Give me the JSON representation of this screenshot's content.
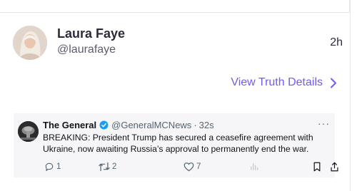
{
  "post": {
    "author_name": "Laura Faye",
    "author_handle": "@laurafaye",
    "time": "2h"
  },
  "details_link": {
    "label": "View Truth Details"
  },
  "tweet": {
    "name": "The General",
    "handle": "@GeneralMCNews",
    "separator": "·",
    "time_ago": "32s",
    "more": "···",
    "text": "BREAKING: President Trump has secured a ceasefire agreement with Ukraine, now awaiting Russia’s approval to permanently end the war.",
    "replies": "1",
    "reposts": "2",
    "likes": "7"
  },
  "colors": {
    "accent": "#6f5cf0",
    "verified": "#1d9bf0",
    "card_bg": "#f6f6f8"
  },
  "icons": [
    "chevron-right-icon",
    "verified-badge-icon",
    "reply-icon",
    "repost-icon",
    "like-icon",
    "views-icon",
    "bookmark-icon",
    "share-icon"
  ]
}
